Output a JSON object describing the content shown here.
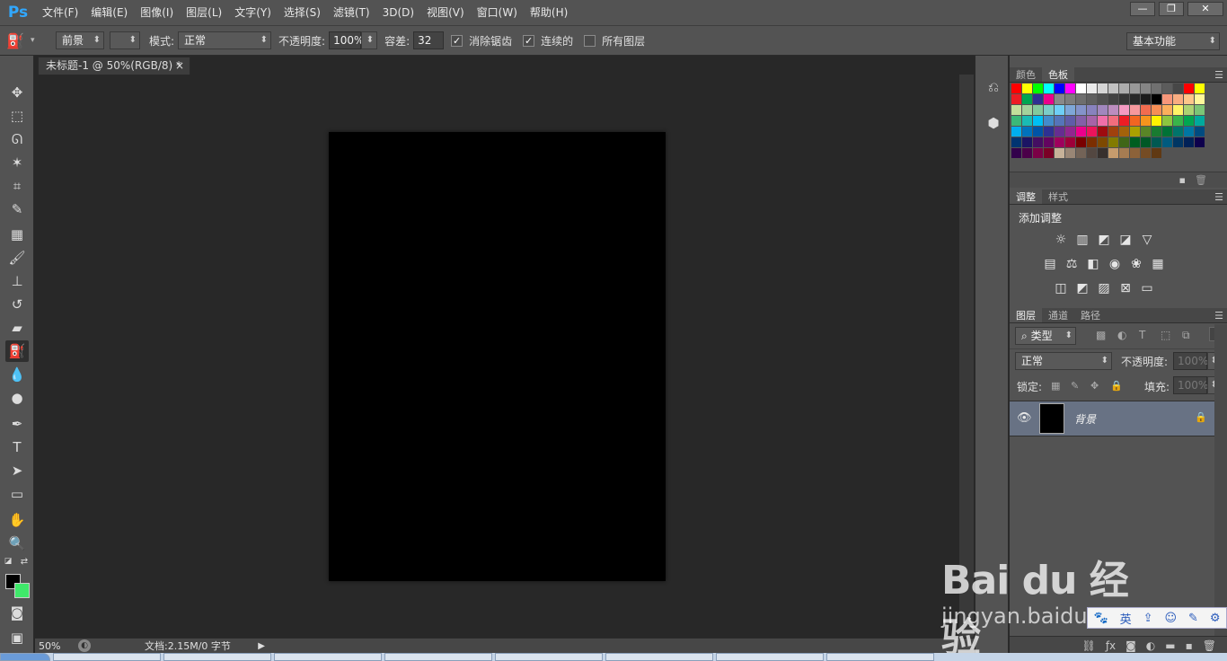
{
  "app": {
    "logo": "Ps"
  },
  "menu": [
    "文件(F)",
    "编辑(E)",
    "图像(I)",
    "图层(L)",
    "文字(Y)",
    "选择(S)",
    "滤镜(T)",
    "3D(D)",
    "视图(V)",
    "窗口(W)",
    "帮助(H)"
  ],
  "window_controls": {
    "minimize": "—",
    "restore": "❐",
    "close": "✕"
  },
  "options": {
    "fill_source": "前景",
    "mode_label": "模式:",
    "mode_value": "正常",
    "opacity_label": "不透明度:",
    "opacity_value": "100%",
    "tolerance_label": "容差:",
    "tolerance_value": "32",
    "antialias_label": "消除锯齿",
    "antialias_checked": true,
    "contiguous_label": "连续的",
    "contiguous_checked": true,
    "all_layers_label": "所有图层",
    "all_layers_checked": false,
    "workspace": "基本功能"
  },
  "document": {
    "tab_title": "未标题-1 @ 50%(RGB/8) *",
    "close": "×",
    "canvas_color": "#000000"
  },
  "status": {
    "zoom": "50%",
    "doc_info": "文档:2.15M/0 字节"
  },
  "panels": {
    "color_tabs": [
      "颜色",
      "色板"
    ],
    "adjust_tabs": [
      "调整",
      "样式"
    ],
    "adjust_title": "添加调整",
    "layers_tabs": [
      "图层",
      "通道",
      "路径"
    ],
    "filter_type": "类型",
    "blend_mode": "正常",
    "opacity_label": "不透明度:",
    "opacity_value": "100%",
    "lock_label": "锁定:",
    "fill_label": "填充:",
    "fill_value": "100%",
    "layer_name": "背景"
  },
  "swatch_colors": [
    [
      "#ff0000",
      "#ffff00",
      "#00ff00",
      "#00ffff",
      "#0000ff",
      "#ff00ff",
      "#ffffff",
      "#ebebeb",
      "#d6d6d6",
      "#c2c2c2",
      "#adadad",
      "#999999",
      "#858585",
      "#707070",
      "#5c5c5c",
      "#474747",
      "#ff0000",
      "#ffff00"
    ],
    [
      "#ed1c24",
      "#00a651",
      "#2e3192",
      "#ec008c",
      "#898989",
      "#7d7d7d",
      "#6e6e6e",
      "#5f5f5f",
      "#515151",
      "#434343",
      "#363636",
      "#292929",
      "#1c1c1c",
      "#000000",
      "#f7977a",
      "#f9ad81",
      "#fdc68a",
      "#fff79a"
    ],
    [
      "#c4df9b",
      "#a3d39c",
      "#82ca9d",
      "#7bcdc8",
      "#6ecff6",
      "#7ea7d8",
      "#8493ca",
      "#8882be",
      "#a187be",
      "#bc8dbf",
      "#f49ac2",
      "#f6989d",
      "#f26c4f",
      "#f68e55",
      "#fbaf5c",
      "#fff467",
      "#acd372",
      "#7cc576"
    ],
    [
      "#3bb878",
      "#1abbb4",
      "#00bff3",
      "#438ccb",
      "#5574b9",
      "#605ca8",
      "#855fa8",
      "#a763a8",
      "#f06ea9",
      "#f26d7d",
      "#ed1c24",
      "#f26522",
      "#f7941d",
      "#fff200",
      "#8dc63f",
      "#39b54a",
      "#00a651",
      "#00a99d"
    ],
    [
      "#00aeef",
      "#0072bc",
      "#0054a6",
      "#2e3192",
      "#662d91",
      "#92278f",
      "#ec008c",
      "#ed145b",
      "#9e0b0f",
      "#a0410d",
      "#a3620a",
      "#aba000",
      "#598527",
      "#197b30",
      "#007236",
      "#00746b",
      "#0076a3",
      "#004b80"
    ],
    [
      "#003471",
      "#1b1464",
      "#440e62",
      "#630460",
      "#9e005d",
      "#9e0039",
      "#790000",
      "#7b2e00",
      "#7d4900",
      "#827b00",
      "#406618",
      "#005e20",
      "#005826",
      "#005952",
      "#005b7f",
      "#003663",
      "#002157",
      "#0d004c"
    ],
    [
      "#32004b",
      "#4b0049",
      "#7b0046",
      "#7a0026",
      "#c7b299",
      "#998675",
      "#736357",
      "#534741",
      "#37302d",
      "#c69c6d",
      "#a67c52",
      "#8c6239",
      "#754c24",
      "#603913"
    ]
  ],
  "icons": {
    "eye": "👁",
    "lock": "🔒",
    "search": "⌕"
  },
  "watermark": {
    "logo": "Bai du 经验",
    "url": "jingyan.baidu.com"
  },
  "ime_bar": [
    "🐾",
    "英",
    "⇪",
    "☺",
    "✎",
    "⚙"
  ]
}
